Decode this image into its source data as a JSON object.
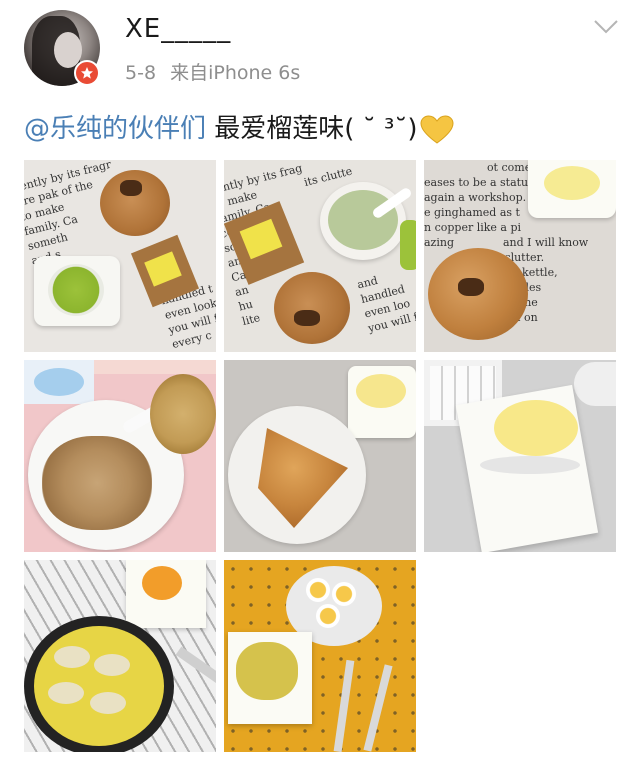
{
  "post": {
    "username": "XE_____",
    "date": "5-8",
    "source": "来自iPhone 6s",
    "mention": "@乐纯的伙伴们",
    "body_text": " 最爱榴莲味( ˘ ³˘)",
    "heart_emoji_color": "#f5c542"
  },
  "images": [
    {
      "subject": "cookie with matcha cup and tea sachet on newspaper text"
    },
    {
      "subject": "matcha yogurt cup with cookie and tea sachet"
    },
    {
      "subject": "cookie with yogurt cup on lettered mat"
    },
    {
      "subject": "granola yogurt bowl"
    },
    {
      "subject": "fried flatbread with yogurt cup"
    },
    {
      "subject": "yogurt cup next to keyboard"
    },
    {
      "subject": "egg pancake with dumplings"
    },
    {
      "subject": "boiled eggs plate and durian yogurt cup"
    }
  ],
  "colors": {
    "mention": "#4a7fb5",
    "meta": "#8e8e8e",
    "badge": "#e94b35"
  }
}
